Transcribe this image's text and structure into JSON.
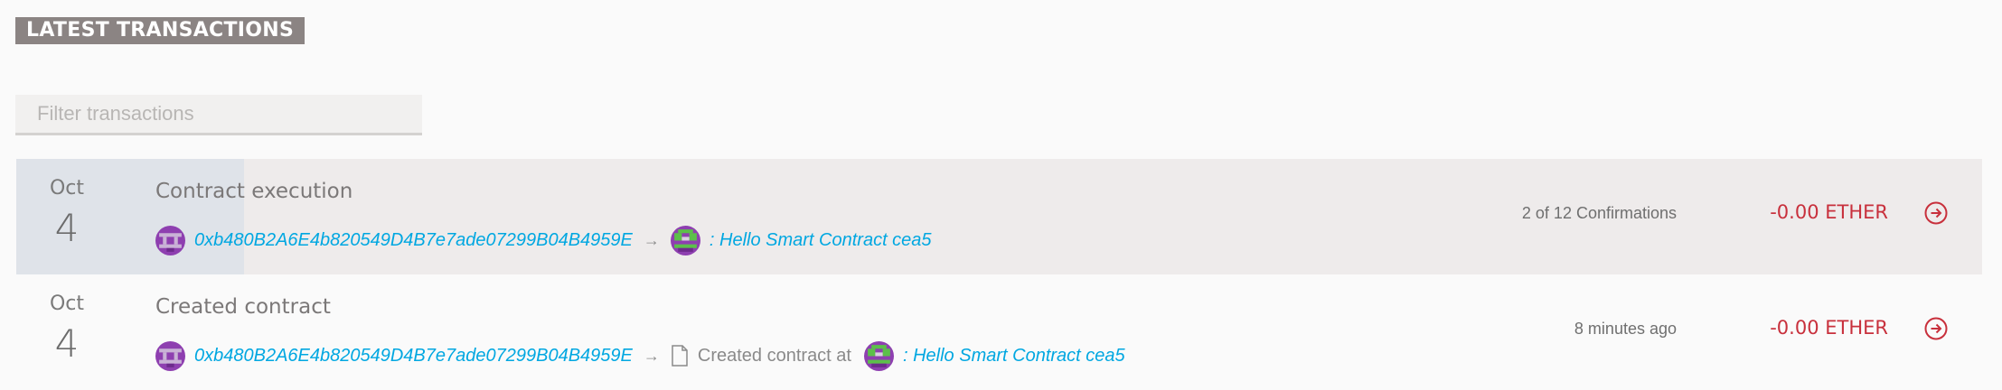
{
  "section": {
    "title": "LATEST TRANSACTIONS"
  },
  "filter": {
    "placeholder": "Filter transactions",
    "value": ""
  },
  "colors": {
    "accent_blue": "#00a7e1",
    "amount_red": "#c8303c",
    "title_bg": "#8b8483"
  },
  "transactions": [
    {
      "month": "Oct",
      "day": "4",
      "title": "Contract execution",
      "from": "0xb480B2A6E4b820549D4B7e7ade07299B04B4959E",
      "arrow": "→",
      "middle_text": "",
      "to": ": Hello Smart Contract cea5",
      "status": "2 of 12 Confirmations",
      "amount": "-0.00 ETHER",
      "icons": {
        "from": "identicon-icon",
        "to": "identicon-icon",
        "go": "arrow-circle-right-icon"
      }
    },
    {
      "month": "Oct",
      "day": "4",
      "title": "Created contract",
      "from": "0xb480B2A6E4b820549D4B7e7ade07299B04B4959E",
      "arrow": "→",
      "middle_text": "Created contract at",
      "to": ": Hello Smart Contract cea5",
      "status": "8 minutes ago",
      "amount": "-0.00 ETHER",
      "icons": {
        "from": "identicon-icon",
        "doc": "document-icon",
        "to": "identicon-icon",
        "go": "arrow-circle-right-icon"
      }
    }
  ]
}
